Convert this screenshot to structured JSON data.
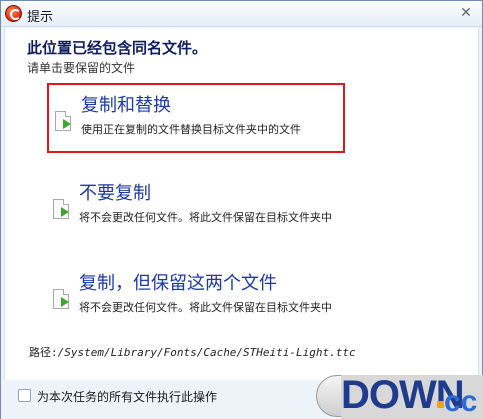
{
  "window": {
    "title": "提示"
  },
  "header": {
    "heading": "此位置已经包含同名文件。",
    "subheading": "请单击要保留的文件"
  },
  "options": [
    {
      "title": "复制和替换",
      "description": "使用正在复制的文件替换目标文件夹中的文件"
    },
    {
      "title": "不要复制",
      "description": "将不会更改任何文件。将此文件保留在目标文件夹中"
    },
    {
      "title": "复制，但保留这两个文件",
      "description": "将不会更改任何文件。将此文件保留在目标文件夹中"
    }
  ],
  "path": {
    "label": "路径:",
    "value": "/System/Library/Fonts/Cache/STHeiti-Light.ttc"
  },
  "footer": {
    "apply_all_label": "为本次任务的所有文件执行此操作",
    "apply_all_checked": false
  },
  "watermark": {
    "text": "DOWN",
    "suffix": "cc"
  },
  "colors": {
    "accent_border": "#e0161e",
    "option_title": "#1b3aa4",
    "heading": "#0f1d60"
  }
}
